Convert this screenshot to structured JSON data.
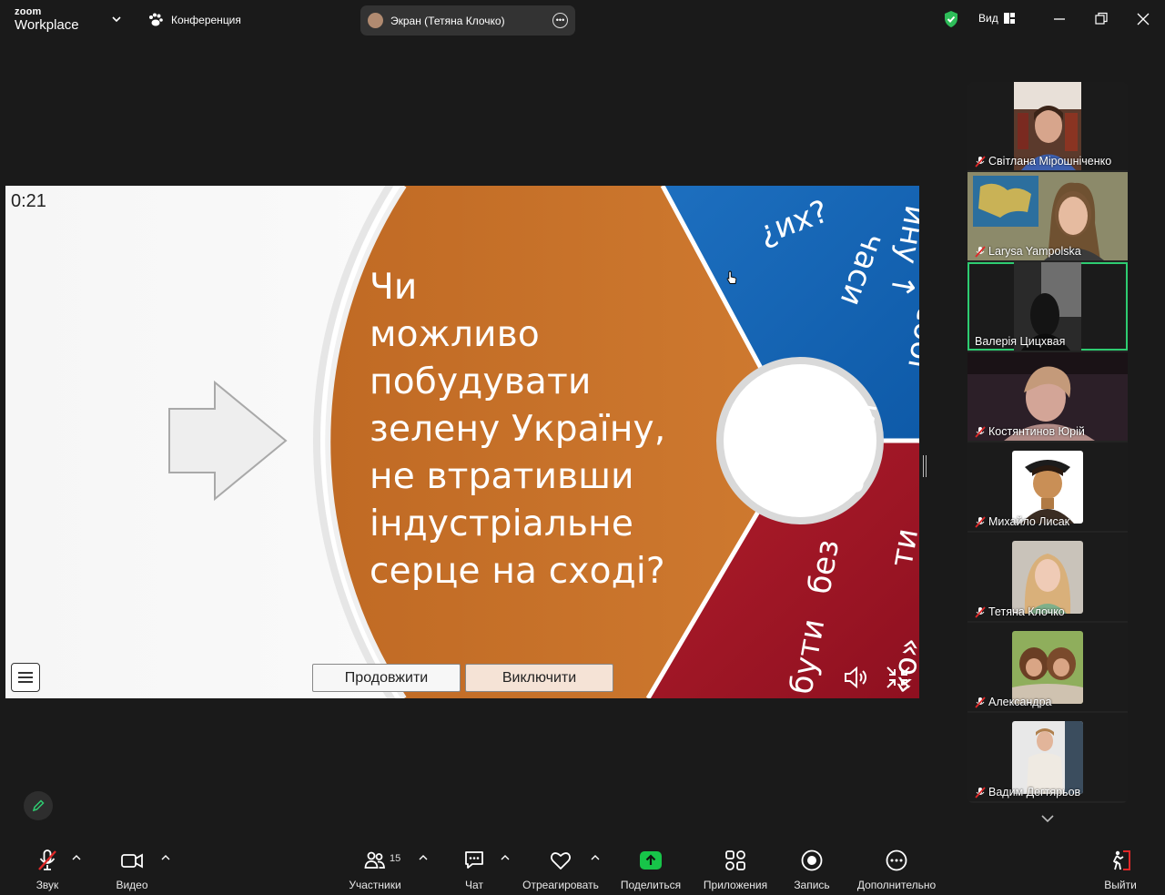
{
  "app": {
    "logo_top": "zoom",
    "logo_bottom": "Workplace",
    "meeting_label": "Конференция",
    "share_title": "Экран (Тетяна Клочко)",
    "view_label": "Вид"
  },
  "presentation": {
    "timer": "0:21",
    "question_lines": [
      "Чи",
      "можливо",
      "побудувати",
      "зелену Україну,",
      "не втративши",
      "індустріальне",
      "серце на сході?"
    ],
    "continue_label": "Продовжити",
    "exclude_label": "Виключити",
    "colors": {
      "orange": "#c8742c",
      "blue": "#1a73c6",
      "red": "#b01e2c",
      "arrow": "#eeeeee"
    }
  },
  "participants": [
    {
      "name": "Світлана Мірошніченко",
      "muted": true,
      "active": false
    },
    {
      "name": "Larysa Yampolska",
      "muted": true,
      "active": false
    },
    {
      "name": "Валерія Цицхвая",
      "muted": false,
      "active": true
    },
    {
      "name": "Костянтинов Юрій",
      "muted": true,
      "active": false
    },
    {
      "name": "Михайло Лисак",
      "muted": true,
      "active": false
    },
    {
      "name": "Тетяна Клочко",
      "muted": true,
      "active": false
    },
    {
      "name": "Александра",
      "muted": true,
      "active": false
    },
    {
      "name": "Вадим Дегтярьов",
      "muted": true,
      "active": false
    }
  ],
  "toolbar": {
    "audio": "Звук",
    "video": "Видео",
    "participants": "Участники",
    "participants_count": "15",
    "chat": "Чат",
    "react": "Отреагировать",
    "share": "Поделиться",
    "apps": "Приложения",
    "record": "Запись",
    "more": "Дополнительно",
    "leave": "Выйти"
  }
}
